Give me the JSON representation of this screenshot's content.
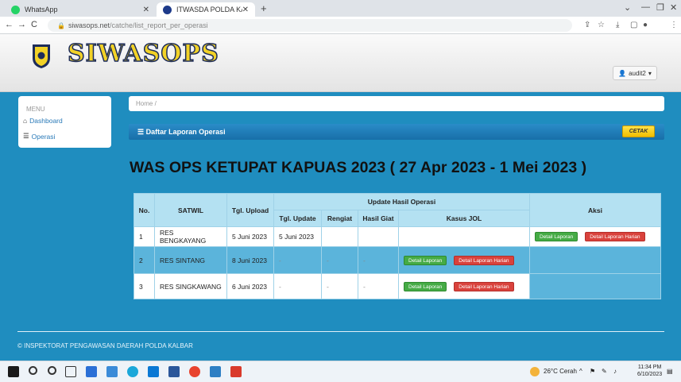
{
  "browser": {
    "tabs": [
      {
        "label": "WhatsApp",
        "icon": "whatsapp-icon",
        "color": "#25d366"
      },
      {
        "label": "ITWASDA POLDA KALBAR",
        "icon": "site-emblem-icon",
        "color": "#1d3a8a"
      }
    ],
    "url_host": "siwasops.net",
    "url_path": "/catche/list_report_per_operasi"
  },
  "header": {
    "brand": "SIWASOPS",
    "user": "audit2"
  },
  "sidebar": {
    "title": "MENU",
    "items": [
      {
        "label": "Dashboard",
        "icon": "home-icon"
      },
      {
        "label": "Operasi",
        "icon": "list-icon"
      }
    ]
  },
  "breadcrumb": {
    "home": "Home",
    "sep": "/"
  },
  "section": {
    "title": "Daftar Laporan Operasi",
    "print_label": "CETAK"
  },
  "report_title": "WAS OPS KETUPAT KAPUAS 2023 ( 27 Apr 2023 - 1 Mei 2023 )",
  "table": {
    "group_header": "Update Hasil Operasi",
    "columns": [
      "No.",
      "SATWIL",
      "Tgl. Upload",
      "Tgl. Update",
      "Rengiat",
      "Hasil Giat",
      "Kasus JOL",
      "Aksi"
    ],
    "rows": [
      {
        "no": "1",
        "satwil": "RES BENGKAYANG",
        "upload": "5 Juni 2023",
        "update": "5 Juni 2023",
        "rengiat": "",
        "hasil": ""
      },
      {
        "no": "2",
        "satwil": "RES SINTANG",
        "upload": "8 Juni 2023",
        "update": "-",
        "rengiat": "-",
        "hasil": "-"
      },
      {
        "no": "3",
        "satwil": "RES SINGKAWANG",
        "upload": "6 Juni 2023",
        "update": "-",
        "rengiat": "-",
        "hasil": "-"
      }
    ],
    "btn_detail": "Detail Laporan",
    "btn_daily": "Detail Laporan Harian"
  },
  "footer": "© INSPEKTORAT PENGAWASAN DAERAH POLDA KALBAR",
  "taskbar": {
    "weather": "26°C Cerah",
    "time": "11:34 PM",
    "date": "6/10/2023"
  }
}
